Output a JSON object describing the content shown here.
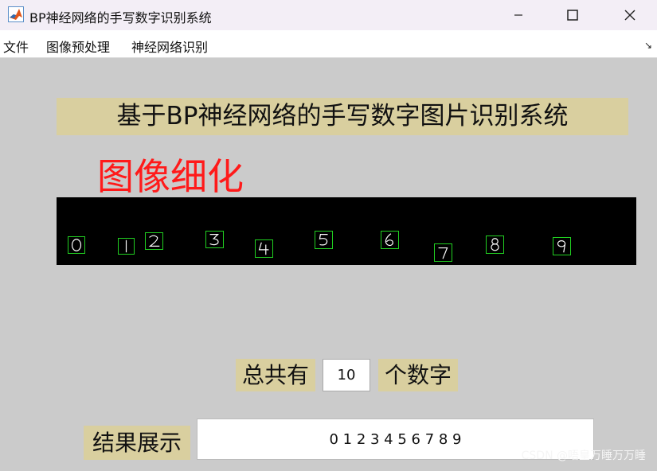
{
  "window": {
    "title": "BP神经网络的手写数字识别系统",
    "controls": [
      "minimize",
      "maximize",
      "close"
    ]
  },
  "menu": {
    "items": [
      "文件",
      "图像预处理",
      "神经网络识别"
    ]
  },
  "main": {
    "title": "基于BP神经网络的手写数字图片识别系统",
    "step_label": "图像细化",
    "digits_image": {
      "digits": [
        "0",
        "1",
        "2",
        "3",
        "4",
        "5",
        "6",
        "7",
        "8",
        "9"
      ],
      "box_color": "#21d021"
    },
    "count": {
      "prefix": "总共有",
      "value": "10",
      "suffix": "个数字"
    },
    "result": {
      "label": "结果展示",
      "value": "0 1 2 3 4 5 6 7 8 9"
    }
  },
  "watermark": "CSDN @唔皇万睡万万睡",
  "colors": {
    "panel_bg": "#d9cf9f",
    "window_bg": "#cbcbcb",
    "step_label": "#ff1a1a"
  }
}
